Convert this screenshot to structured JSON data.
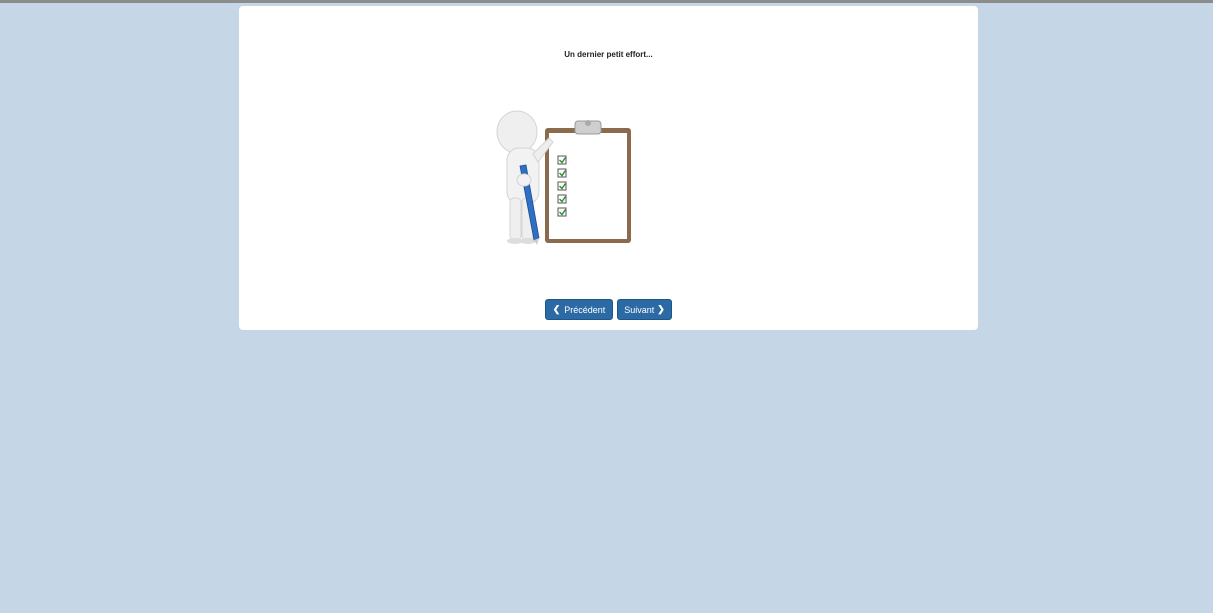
{
  "page": {
    "title": "Un dernier petit effort..."
  },
  "illustration": {
    "icon": "person-clipboard-checklist-icon",
    "checkbox_count": 5
  },
  "nav": {
    "prev_label": "Précédent",
    "prev_icon": "chevron-left-icon",
    "next_label": "Suivant",
    "next_icon": "chevron-right-icon"
  },
  "colors": {
    "background": "#c5d7e7",
    "button": "#2c6aa5",
    "card": "#ffffff"
  }
}
